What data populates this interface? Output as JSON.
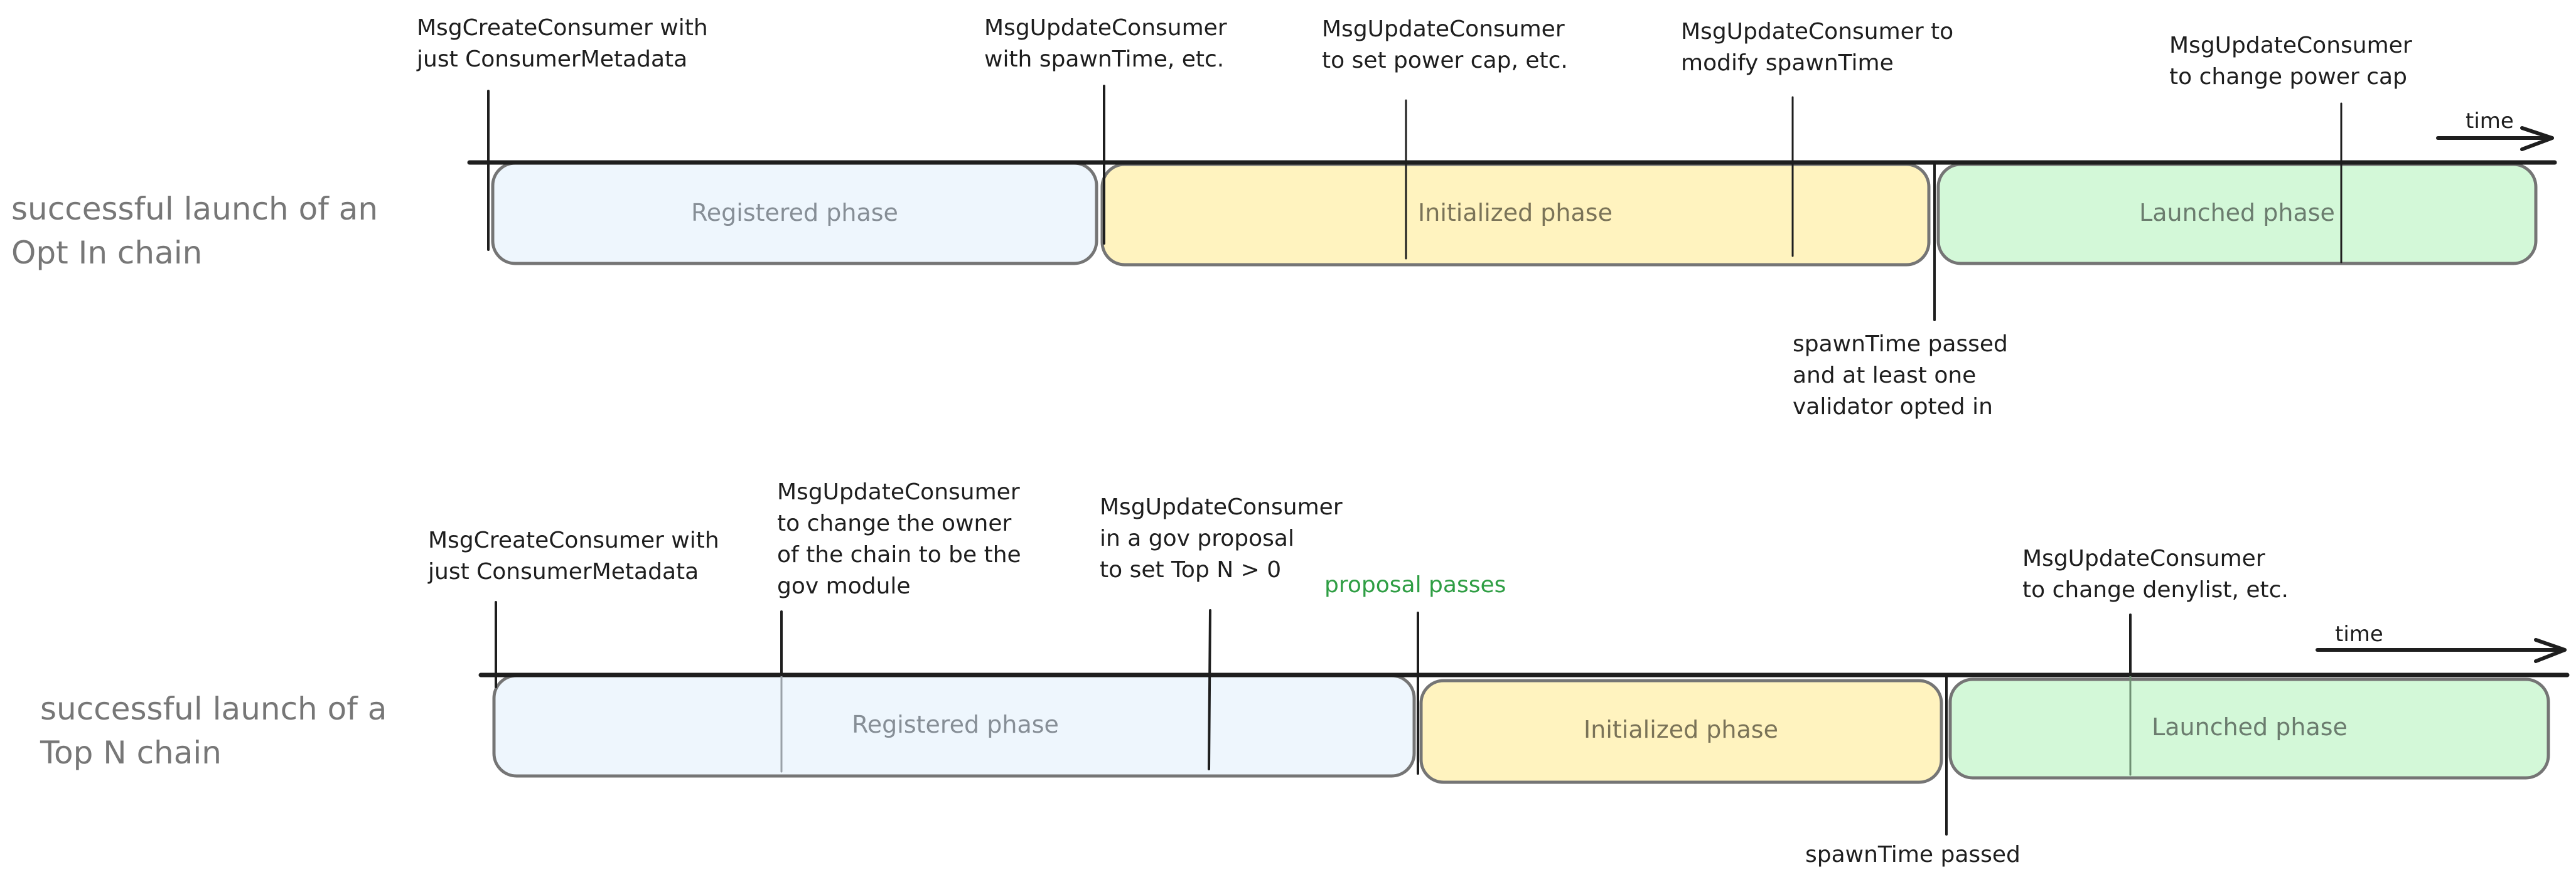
{
  "colors": {
    "registered_fill": "#eef6fd",
    "initialized_fill": "#fff3bf",
    "launched_fill": "#d3f8d8",
    "registered_text": "#868e96",
    "initialized_text": "#7a7358",
    "launched_text": "#6b7c6e",
    "ink": "#1e1e1e",
    "title": "#777777",
    "accent_green": "#2f9e44"
  },
  "time_label": "time",
  "rows": [
    {
      "title": [
        "successful launch of an",
        "Opt In chain"
      ],
      "phases": [
        {
          "name": "registered",
          "label": "Registered phase"
        },
        {
          "name": "initialized",
          "label": "Initialized phase"
        },
        {
          "name": "launched",
          "label": "Launched phase"
        }
      ],
      "events_above": [
        {
          "lines": [
            "MsgCreateConsumer with",
            "just ConsumerMetadata"
          ]
        },
        {
          "lines": [
            "MsgUpdateConsumer",
            "with spawnTime, etc."
          ]
        },
        {
          "lines": [
            "MsgUpdateConsumer",
            "to set power cap, etc."
          ]
        },
        {
          "lines": [
            "MsgUpdateConsumer to",
            "modify spawnTime"
          ]
        },
        {
          "lines": [
            "MsgUpdateConsumer",
            "to change power cap"
          ]
        }
      ],
      "events_below": [
        {
          "lines": [
            "spawnTime passed",
            "and at least one",
            "validator opted in"
          ]
        }
      ]
    },
    {
      "title": [
        "successful launch of a",
        "Top N chain"
      ],
      "phases": [
        {
          "name": "registered",
          "label": "Registered phase"
        },
        {
          "name": "initialized",
          "label": "Initialized phase"
        },
        {
          "name": "launched",
          "label": "Launched phase"
        }
      ],
      "events_above": [
        {
          "lines": [
            "MsgCreateConsumer with",
            "just ConsumerMetadata"
          ]
        },
        {
          "lines": [
            "MsgUpdateConsumer",
            "to change the owner",
            "of the chain to be the",
            "gov module"
          ]
        },
        {
          "lines": [
            "MsgUpdateConsumer",
            "in a gov proposal",
            "to set Top N > 0"
          ]
        },
        {
          "lines": [
            "proposal passes"
          ],
          "color": "green"
        },
        {
          "lines": [
            "MsgUpdateConsumer",
            "to change denylist, etc."
          ]
        }
      ],
      "events_below": [
        {
          "lines": [
            "spawnTime passed"
          ]
        }
      ]
    }
  ]
}
